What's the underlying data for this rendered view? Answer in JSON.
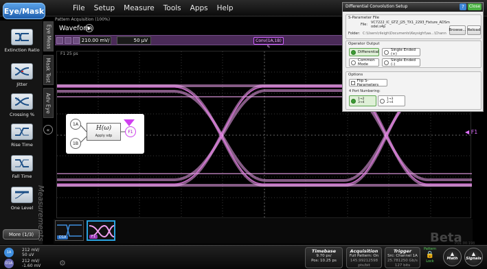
{
  "menubar": {
    "app_button": "Eye/Mask",
    "items": [
      "File",
      "Setup",
      "Measure",
      "Tools",
      "Apps",
      "Help"
    ]
  },
  "sidebar": {
    "tools": [
      {
        "label": "Extinction Ratio",
        "icon": "extinction-ratio-icon"
      },
      {
        "label": "Jitter",
        "icon": "jitter-icon"
      },
      {
        "label": "Crossing %",
        "icon": "crossing-percent-icon"
      },
      {
        "label": "Rise Time",
        "icon": "rise-time-icon"
      },
      {
        "label": "Fall Time",
        "icon": "fall-time-icon"
      },
      {
        "label": "One Level",
        "icon": "one-level-icon"
      }
    ],
    "more_button": "More (1/3)",
    "measurements_label": "Measurements"
  },
  "vtabs": [
    "Eye Meas",
    "Mask Test",
    "Adv Eye"
  ],
  "waveform": {
    "acquisition_label": "Pattern Acquisition  (100%)",
    "title": "Waveform",
    "scale": "210.00 mV/",
    "offset": "50 µV",
    "conv_chip": "Conv(1A,1B)",
    "plot_label": "F1 25 ps",
    "f1_marker": "◀ F1"
  },
  "diagram": {
    "in_a": "1A",
    "in_b": "1B",
    "function": "H(ω)",
    "apply": "Apply sdp",
    "out": "F1"
  },
  "thumbnails": [
    {
      "label": "D1A"
    },
    {
      "label": "F1"
    }
  ],
  "beta": {
    "text": "Beta",
    "sub": "P.01.00.198"
  },
  "bottom": {
    "ch1a": {
      "badge": "1A",
      "lines": [
        "212 mV/",
        "50 uV"
      ]
    },
    "ch1b": {
      "badge": "D1A",
      "lines": [
        "212 mV/",
        "-1.60 mV"
      ]
    },
    "timebase": {
      "title": "Timebase",
      "lines": [
        "9.70 ps/",
        "Pos: 10.25 ps"
      ]
    },
    "acquisition": {
      "title": "Acquisition",
      "lines": [
        "Full Pattern: On",
        "145.99212598 pts/bit"
      ]
    },
    "trigger": {
      "title": "Trigger",
      "lines": [
        "Src: Channel 1A",
        "25.781250 Gb/s",
        "127 bits"
      ]
    },
    "pattern": {
      "title": "Pattern",
      "status": "Lock"
    },
    "math_button": "Math",
    "signals_button": "Signals"
  },
  "dialog": {
    "title": "Differential Convolution Setup",
    "help": "?",
    "close": "Close",
    "sparam": {
      "group": "S-Parameter File",
      "file_label": "File:",
      "file_value_1": "VC7222_IC_GTZ_J25_TX1_2293_Fixture_ADSm",
      "file_value_2": "odel.s4p",
      "folder_label": "Folder:",
      "folder_value": "C:\\Users\\rileigh\\Documents\\Keysight\\aa...\\Channel_C",
      "browse": "Browse...",
      "reload": "Reload"
    },
    "operator_output": {
      "group": "Operator Output",
      "options": [
        {
          "label": "Differential",
          "selected": true
        },
        {
          "label": "Single Ended (+)",
          "selected": false
        },
        {
          "label": "Common Mode",
          "selected": false
        },
        {
          "label": "Single Ended (-)",
          "selected": false
        }
      ]
    },
    "options": {
      "group": "Options",
      "flip": "Flip S-Parameters",
      "port_numbering": "4 Port Numbering:",
      "port_opts": [
        {
          "top": "1→2",
          "bottom": "3→4",
          "selected": true
        },
        {
          "top": "1→3",
          "bottom": "2→4",
          "selected": false
        }
      ]
    }
  },
  "colors": {
    "accent": "#e070ff",
    "menu_btn": "#2f7fd0",
    "dialog_bg": "#ececec",
    "selected": "#3c9a34"
  }
}
